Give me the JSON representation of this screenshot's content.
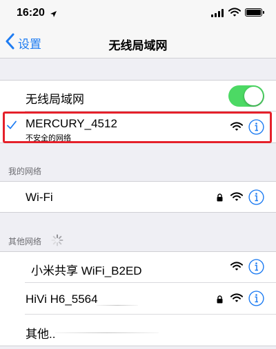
{
  "status_bar": {
    "time": "16:20"
  },
  "nav": {
    "back_label": "设置",
    "title": "无线局域网"
  },
  "wlan_toggle": {
    "label": "无线局域网",
    "on": true
  },
  "connected_network": {
    "name": "MERCURY_4512",
    "subtitle": "不安全的网络"
  },
  "my_networks": {
    "header": "我的网络",
    "items": [
      {
        "name": "Wi-Fi",
        "secured": true
      }
    ]
  },
  "other_networks": {
    "header": "其他网络",
    "items": [
      {
        "name": "小米共享 WiFi_B2ED",
        "secured": false
      },
      {
        "name": "HiVi H6_5564",
        "secured": true
      }
    ],
    "other_label": "其他.."
  },
  "colors": {
    "accent": "#1e7cf2",
    "toggle_on": "#4cd964",
    "highlight": "#e5202a"
  }
}
